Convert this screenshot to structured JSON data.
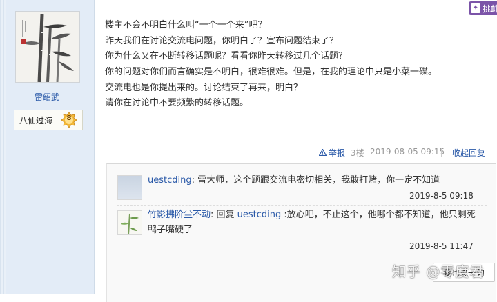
{
  "user": {
    "name": "雷绍武",
    "rank_title": "八仙过海",
    "rank_level": "8"
  },
  "promo": {
    "label": "挑衅"
  },
  "post": {
    "lines": [
      "楼主不会不明白什么叫“一个一个来”吧？",
      "昨天我们在讨论交流电问题，你明白了？宣布问题结束了？",
      "你为什么又在不断转移话题呢？看看你昨天转移过几个话题？",
      "你的问题对你们而言确实是不明白，很难很难。但是，在我的理论中只是小菜一碟。",
      "交流电也是你提出来的。讨论结束了再来，明白？",
      "请你在讨论中不要频繁的转移话题。"
    ],
    "report_label": "举报",
    "floor": "3楼",
    "time": "2019-08-05 09:15",
    "collapse_label": "收起回复"
  },
  "comments": [
    {
      "user": "uestcding",
      "text": ": 雷大师，这个题跟交流电密切相关，我敢打赌，你一定不知道",
      "time": "2019-8-5 09:18"
    },
    {
      "user": "竹影拂阶尘不动",
      "reply_word": ": 回复 ",
      "reply_to": "uestcding",
      "text_line1": " :放心吧，不止这个，他哪个都不知道，他只剩死",
      "text_line2": "鸭子嘴硬了",
      "time": "2019-8-5 11:47"
    }
  ],
  "reply_button": "我也说一句",
  "watermark": "知乎 @零度君"
}
